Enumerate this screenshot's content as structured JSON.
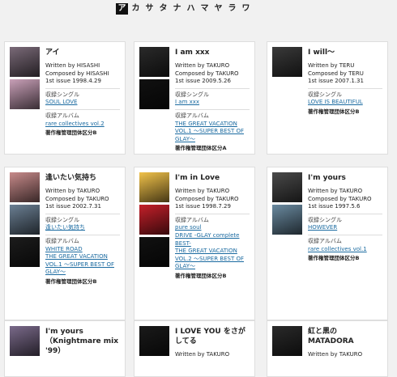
{
  "kana_nav": [
    {
      "label": "ア",
      "active": true
    },
    {
      "label": "カ",
      "active": false
    },
    {
      "label": "サ",
      "active": false
    },
    {
      "label": "タ",
      "active": false
    },
    {
      "label": "ナ",
      "active": false
    },
    {
      "label": "ハ",
      "active": false
    },
    {
      "label": "マ",
      "active": false
    },
    {
      "label": "ヤ",
      "active": false
    },
    {
      "label": "ラ",
      "active": false
    },
    {
      "label": "ワ",
      "active": false
    }
  ],
  "cards": [
    {
      "title": "アイ",
      "written": "Written by HISASHI",
      "composed": "Composed by HISASHI",
      "issue": "1st issue 1998.4.29",
      "single_label": "収録シングル",
      "singles": [
        "SOUL LOVE"
      ],
      "album_label": "収録アルバム",
      "albums": [
        "rare collectives vol.2"
      ],
      "group": "著作権管理団体区分B",
      "thumb_colors": [
        "#7a6a78",
        "#c9a0b8"
      ]
    },
    {
      "title": "I am xxx",
      "written": "Written by TAKURO",
      "composed": "Composed by TAKURO",
      "issue": "1st issue 2009.5.26",
      "single_label": "収録シングル",
      "singles": [
        "I am xxx"
      ],
      "album_label": "収録アルバム",
      "albums": [
        "THE GREAT VACATION VOL.1 ～SUPER BEST OF GLAY～"
      ],
      "group": "著作権管理団体区分A",
      "thumb_colors": [
        "#2a2a2a",
        "#111111"
      ]
    },
    {
      "title": "I will～",
      "written": "Written by TERU",
      "composed": "Composed by TERU",
      "issue": "1st issue 2007.1.31",
      "single_label": "収録シングル",
      "singles": [
        "LOVE IS BEAUTIFUL"
      ],
      "album_label": "",
      "albums": [],
      "group": "著作権管理団体区分B",
      "thumb_colors": [
        "#3a3a3a"
      ]
    },
    {
      "title": "逢いたい気持ち",
      "written": "Written by TAKURO",
      "composed": "Composed by TAKURO",
      "issue": "1st issue 2002.7.31",
      "single_label": "収録シングル",
      "singles": [
        "逢いたい気持ち"
      ],
      "album_label": "収録アルバム",
      "albums": [
        "WHITE ROAD",
        "THE GREAT VACATION VOL.1 ～SUPER BEST OF GLAY～"
      ],
      "group": "著作権管理団体区分B",
      "thumb_colors": [
        "#c78a8a",
        "#6b7f93",
        "#1c1c1c"
      ]
    },
    {
      "title": "I'm in Love",
      "written": "Written by TAKURO",
      "composed": "Composed by TAKURO",
      "issue": "1st issue 1998.7.29",
      "single_label": "収録アルバム",
      "singles": [
        "pure soul",
        "DRIVE -GLAY complete BEST-",
        "THE GREAT VACATION VOL.2 ～SUPER BEST OF GLAY～"
      ],
      "album_label": "",
      "albums": [],
      "group": "著作権管理団体区分B",
      "thumb_colors": [
        "#f1c24a",
        "#c4202a",
        "#111111"
      ]
    },
    {
      "title": "I'm yours",
      "written": "Written by TAKURO",
      "composed": "Composed by TAKURO",
      "issue": "1st issue 1997.5.6",
      "single_label": "収録シングル",
      "singles": [
        "HOWEVER"
      ],
      "album_label": "収録アルバム",
      "albums": [
        "rare collectives vol.1"
      ],
      "group": "著作権管理団体区分B",
      "thumb_colors": [
        "#4a4a4a",
        "#6a8aa0"
      ]
    },
    {
      "title": "I'm yours（Knightmare mix '99）",
      "written": "",
      "composed": "",
      "issue": "",
      "single_label": "",
      "singles": [],
      "album_label": "",
      "albums": [],
      "group": "",
      "thumb_colors": [
        "#7a6a8a"
      ]
    },
    {
      "title": "I LOVE YOU をさがしてる",
      "written": "Written by TAKURO",
      "composed": "",
      "issue": "",
      "single_label": "",
      "singles": [],
      "album_label": "",
      "albums": [],
      "group": "",
      "thumb_colors": [
        "#1a1a1a"
      ]
    },
    {
      "title": "紅と黒のMATADORA",
      "written": "Written by TAKURO",
      "composed": "",
      "issue": "",
      "single_label": "",
      "singles": [],
      "album_label": "",
      "albums": [],
      "group": "",
      "thumb_colors": [
        "#2a2a2a"
      ]
    }
  ]
}
